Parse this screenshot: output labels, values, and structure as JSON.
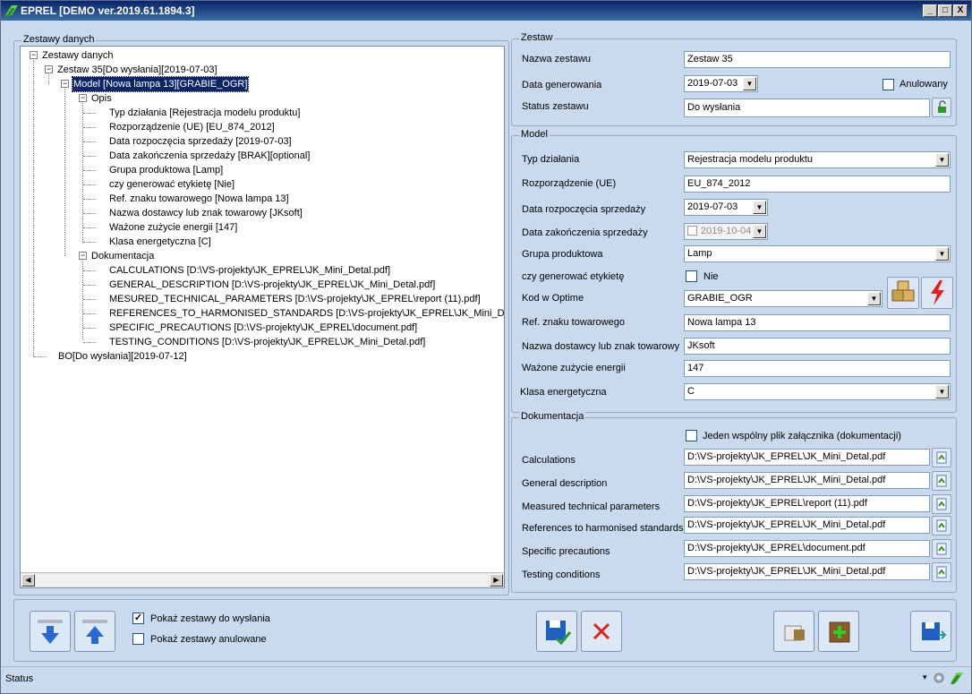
{
  "window": {
    "title": "EPREL [DEMO ver.2019.61.1894.3]",
    "controls": [
      "_",
      "□",
      "X"
    ]
  },
  "tree_panel": {
    "legend": "Zestawy danych",
    "nodes": {
      "root": "Zestawy danych",
      "zestaw": "Zestaw  35[Do wysłania][2019-07-03]",
      "model": "Model [Nowa lampa 13][GRABIE_OGR]",
      "opis": "Opis",
      "opis_items": [
        "Typ działania [Rejestracja modelu produktu]",
        "Rozporządzenie (UE) [EU_874_2012]",
        "Data rozpoczęcia sprzedaży [2019-07-03]",
        "Data zakończenia sprzedaży [BRAK][optional]",
        "Grupa produktowa [Lamp]",
        "czy generować etykietę [Nie]",
        "Ref. znaku towarowego [Nowa lampa 13]",
        "Nazwa dostawcy lub znak towarowy [JKsoft]",
        "Ważone zużycie energii [147]",
        "Klasa energetyczna [C]"
      ],
      "dokumentacja": "Dokumentacja",
      "dok_items": [
        "CALCULATIONS [D:\\VS-projekty\\JK_EPREL\\JK_Mini_Detal.pdf]",
        "GENERAL_DESCRIPTION [D:\\VS-projekty\\JK_EPREL\\JK_Mini_Detal.pdf]",
        "MESURED_TECHNICAL_PARAMETERS [D:\\VS-projekty\\JK_EPREL\\report (11).pdf]",
        "REFERENCES_TO_HARMONISED_STANDARDS [D:\\VS-projekty\\JK_EPREL\\JK_Mini_De",
        "SPECIFIC_PRECAUTIONS [D:\\VS-projekty\\JK_EPREL\\document.pdf]",
        "TESTING_CONDITIONS [D:\\VS-projekty\\JK_EPREL\\JK_Mini_Detal.pdf]"
      ],
      "bo": "BO[Do wysłania][2019-07-12]"
    }
  },
  "zestaw": {
    "legend": "Zestaw",
    "nazwa_label": "Nazwa zestawu",
    "nazwa_value": "Zestaw  35",
    "data_label": "Data generowania",
    "data_value": "2019-07-03",
    "anulowany_label": "Anulowany",
    "status_label": "Status zestawu",
    "status_value": "Do wysłania"
  },
  "model": {
    "legend": "Model",
    "typ_label": "Typ działania",
    "typ_value": "Rejestracja modelu produktu",
    "rozp_label": "Rozporządzenie (UE)",
    "rozp_value": "EU_874_2012",
    "start_label": "Data rozpoczęcia sprzedaży",
    "start_value": "2019-07-03",
    "end_label": "Data zakończenia sprzedaży",
    "end_value": "2019-10-04",
    "grupa_label": "Grupa produktowa",
    "grupa_value": "Lamp",
    "etykieta_label": "czy generować etykietę",
    "etykieta_value": "Nie",
    "kod_label": "Kod w Optime",
    "kod_value": "GRABIE_OGR",
    "ref_label": "Ref. znaku towarowego",
    "ref_value": "Nowa lampa 13",
    "dostawca_label": "Nazwa dostawcy lub znak towarowy",
    "dostawca_value": "JKsoft",
    "zuzycie_label": "Ważone zużycie energii",
    "zuzycie_value": "147",
    "klasa_label": "Klasa energetyczna",
    "klasa_value": "C"
  },
  "dokumentacja": {
    "legend": "Dokumentacja",
    "wspolny_label": "Jeden wspólny plik załącznika (dokumentacji)",
    "rows": [
      {
        "label": "Calculations",
        "value": "D:\\VS-projekty\\JK_EPREL\\JK_Mini_Detal.pdf"
      },
      {
        "label": "General description",
        "value": "D:\\VS-projekty\\JK_EPREL\\JK_Mini_Detal.pdf"
      },
      {
        "label": "Measured technical parameters",
        "value": "D:\\VS-projekty\\JK_EPREL\\report (11).pdf"
      },
      {
        "label": "References to harmonised standards",
        "value": "D:\\VS-projekty\\JK_EPREL\\JK_Mini_Detal.pdf"
      },
      {
        "label": "Specific precautions",
        "value": "D:\\VS-projekty\\JK_EPREL\\document.pdf"
      },
      {
        "label": "Testing conditions",
        "value": "D:\\VS-projekty\\JK_EPREL\\JK_Mini_Detal.pdf"
      }
    ]
  },
  "bottom": {
    "pokaz_do_wyslania": "Pokaż zestawy do wysłania",
    "pokaz_anulowane": "Pokaż zestawy anulowane"
  },
  "statusbar": {
    "text": "Status"
  },
  "colors": {
    "title_gradient_start": "#0a246a",
    "panel_bg": "#c9d9ee",
    "selected_bg": "#0a246a",
    "cancel_red": "#e0201a",
    "green": "#2a9a2a"
  }
}
